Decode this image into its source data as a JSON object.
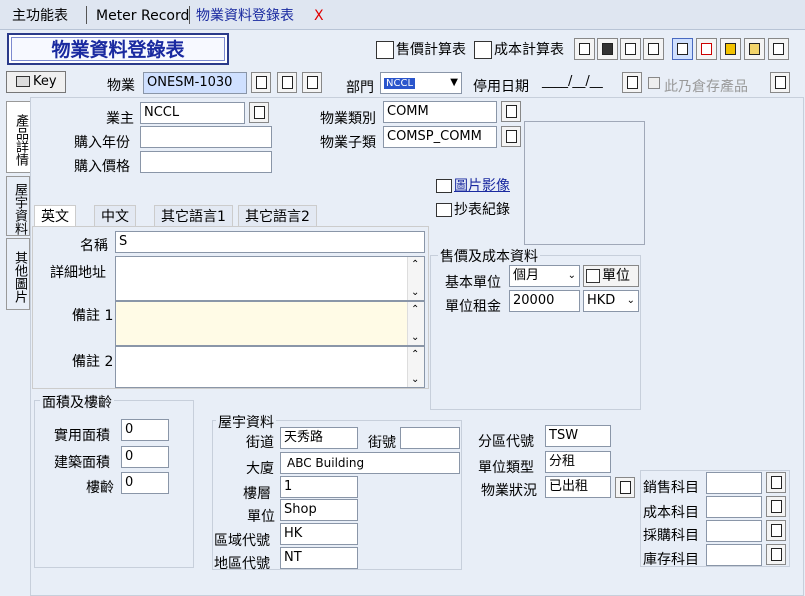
{
  "tabs": [
    "主功能表",
    "Meter Record",
    "物業資料登錄表"
  ],
  "close_glyph": "X",
  "form_title": "物業資料登錄表",
  "toolbar": {
    "sale_calc": "售價計算表",
    "cost_calc": "成本計算表"
  },
  "key_label": "Key",
  "property": {
    "label": "物業",
    "value": "ONESM-1030"
  },
  "dept": {
    "label": "部門",
    "value": "NCCL"
  },
  "stop_date": {
    "label": "停用日期",
    "value": "____/__/__"
  },
  "warehouse_label": "此乃倉存產品",
  "vtabs": [
    "產品詳情",
    "屋宇資料",
    "其他圖片"
  ],
  "owner": {
    "label": "業主",
    "value": "NCCL"
  },
  "buy_year": {
    "label": "購入年份",
    "value": ""
  },
  "buy_price": {
    "label": "購入價格",
    "value": ""
  },
  "prop_type": {
    "label": "物業類別",
    "value": "COMM"
  },
  "prop_subtype": {
    "label": "物業子類",
    "value": "COMSP_COMM"
  },
  "image_link": "圖片影像",
  "meter_link": "抄表紀錄",
  "lang_tabs": [
    "英文",
    "中文",
    "其它語言1",
    "其它語言2"
  ],
  "name_label": "名稱",
  "name_value": "S",
  "address_label": "詳細地址",
  "remark1_label": "備註 1",
  "remark2_label": "備註 2",
  "price_group": "售價及成本資料",
  "base_unit": {
    "label": "基本單位",
    "value": "個月"
  },
  "unit_btn": "單位",
  "unit_rent": {
    "label": "單位租金",
    "value": "20000"
  },
  "currency": "HKD",
  "area_group": "面積及樓齡",
  "usable_area": {
    "label": "實用面積",
    "value": "0"
  },
  "built_area": {
    "label": "建築面積",
    "value": "0"
  },
  "age": {
    "label": "樓齡",
    "value": "0"
  },
  "building_group": "屋宇資料",
  "street": {
    "label": "街道",
    "value": "天秀路"
  },
  "street_no": {
    "label": "街號",
    "value": ""
  },
  "building": {
    "label": "大廈",
    "value": "ABC Building"
  },
  "floor": {
    "label": "樓層",
    "value": "1"
  },
  "unit": {
    "label": "單位",
    "value": "Shop"
  },
  "area_code": {
    "label": "區域代號",
    "value": "HK"
  },
  "region_code": {
    "label": "地區代號",
    "value": "NT"
  },
  "district_code": {
    "label": "分區代號",
    "value": "TSW"
  },
  "unit_type": {
    "label": "單位類型",
    "value": "分租"
  },
  "prop_status": {
    "label": "物業狀況",
    "value": "已出租"
  },
  "accounts": [
    "銷售科目",
    "成本科目",
    "採購科目",
    "庫存科目"
  ],
  "colors": {
    "title_blue": "#1a2aa0",
    "close_red": "#e00000",
    "selected": "#cfe0ff"
  }
}
